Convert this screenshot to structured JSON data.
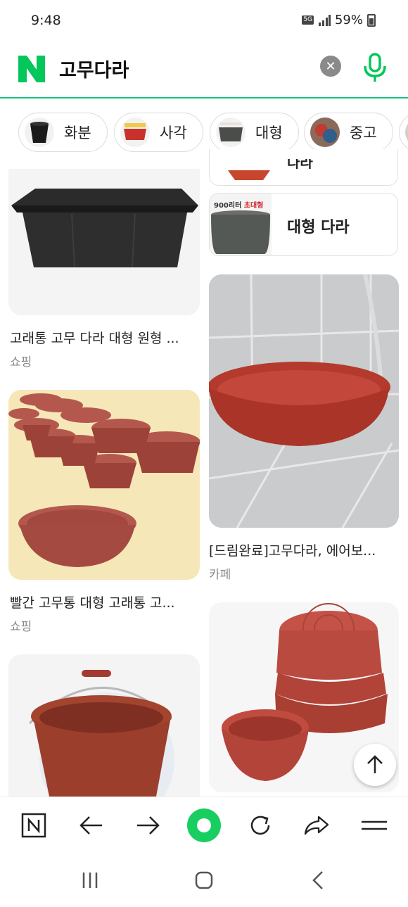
{
  "status": {
    "time": "9:48",
    "network": "5G",
    "battery": "59%"
  },
  "search": {
    "query": "고무다라"
  },
  "chips": [
    {
      "label": "화분"
    },
    {
      "label": "사각"
    },
    {
      "label": "대형"
    },
    {
      "label": "중고"
    }
  ],
  "related": {
    "top_partial_label": "다라",
    "thumb_text_a": "900리터",
    "thumb_text_b": "초대형",
    "label": "대형 다라"
  },
  "results": [
    {
      "caption": "고래통 고무 다라 대형 원형 ...",
      "source": "쇼핑"
    },
    {
      "caption": "빨간 고무통 대형 고래통 고...",
      "source": "쇼핑"
    },
    {
      "caption": "[드림완료]고무다라, 에어보...",
      "source": "카페"
    }
  ],
  "colors": {
    "accent": "#19c37d",
    "naver_green": "#03c75a",
    "basin_red": "#c94a3a"
  },
  "icons": {
    "toolbar": [
      "naver-home-icon",
      "back-arrow-icon",
      "forward-arrow-icon",
      "green-dot-icon",
      "refresh-icon",
      "share-icon",
      "menu-icon"
    ],
    "sysnav": [
      "recents-icon",
      "home-icon",
      "back-icon"
    ]
  }
}
